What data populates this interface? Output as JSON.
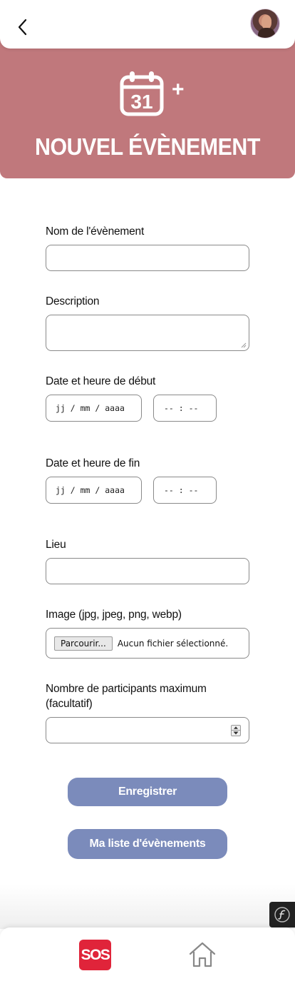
{
  "colors": {
    "hero_bg": "#c0787c",
    "button_bg": "#7b8bbb",
    "sos_red": "#e0243a"
  },
  "header": {
    "back_icon": "chevron-left-icon",
    "avatar_icon": "user-avatar"
  },
  "hero": {
    "calendar_day": "31",
    "plus": "+",
    "title": "NOUVEL ÉVÈNEMENT"
  },
  "form": {
    "name_label": "Nom de l'évènement",
    "name_value": "",
    "description_label": "Description",
    "description_value": "",
    "start_label": "Date et heure de début",
    "start_date_placeholder": "jj / mm / aaaa",
    "start_time_placeholder": "-- : --",
    "end_label": "Date et heure de fin",
    "end_date_placeholder": "jj / mm / aaaa",
    "end_time_placeholder": "-- : --",
    "place_label": "Lieu",
    "place_value": "",
    "image_label": "Image (jpg, jpeg, png, webp)",
    "file_button": "Parcourir...",
    "file_status": "Aucun fichier sélectionné.",
    "max_label_line1": "Nombre de participants maximum",
    "max_label_line2": "(facultatif)",
    "max_value": ""
  },
  "actions": {
    "save": "Enregistrer",
    "my_events": "Ma liste d'évènements"
  },
  "bottom_nav": {
    "sos": "SOS",
    "home_icon": "home-icon"
  }
}
